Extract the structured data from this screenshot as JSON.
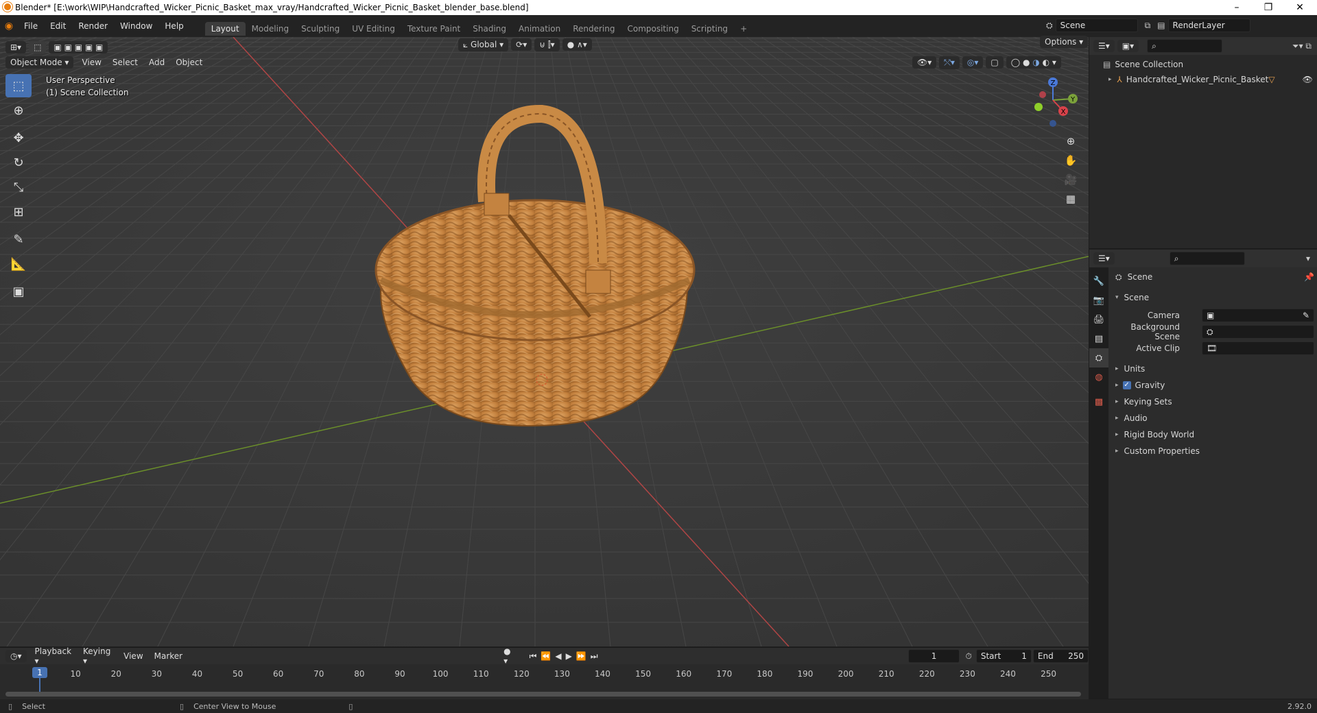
{
  "window": {
    "title": "Blender* [E:\\work\\WIP\\Handcrafted_Wicker_Picnic_Basket_max_vray/Handcrafted_Wicker_Picnic_Basket_blender_base.blend]",
    "controls": [
      "–",
      "❐",
      "✕"
    ]
  },
  "menu": [
    "File",
    "Edit",
    "Render",
    "Window",
    "Help"
  ],
  "workspaces": [
    "Layout",
    "Modeling",
    "Sculpting",
    "UV Editing",
    "Texture Paint",
    "Shading",
    "Animation",
    "Rendering",
    "Compositing",
    "Scripting"
  ],
  "active_workspace": "Layout",
  "scene_field": "Scene",
  "renderlayer_field": "RenderLayer",
  "viewport": {
    "mode": "Object Mode",
    "menus": [
      "View",
      "Select",
      "Add",
      "Object"
    ],
    "orientation": "Global",
    "options": "Options",
    "info_line1": "User Perspective",
    "info_line2": "(1) Scene Collection",
    "gizmo": {
      "z": "Z",
      "y": "Y",
      "x": "X"
    }
  },
  "tools": [
    "select-box",
    "cursor",
    "move",
    "rotate",
    "scale",
    "transform",
    "annotate",
    "measure",
    "add-cube"
  ],
  "outliner": {
    "root": "Scene Collection",
    "items": [
      {
        "label": "Handcrafted_Wicker_Picnic_Basket"
      }
    ]
  },
  "properties": {
    "header": "Scene",
    "section": "Scene",
    "fields": [
      {
        "label": "Camera"
      },
      {
        "label": "Background Scene"
      },
      {
        "label": "Active Clip"
      }
    ],
    "panels": [
      "Units",
      "Gravity",
      "Keying Sets",
      "Audio",
      "Rigid Body World",
      "Custom Properties"
    ],
    "gravity_checked": true
  },
  "timeline": {
    "menus": [
      "Playback",
      "Keying",
      "View",
      "Marker"
    ],
    "current_frame": "1",
    "start_label": "Start",
    "start": "1",
    "end_label": "End",
    "end": "250",
    "ticks": [
      "10",
      "20",
      "30",
      "40",
      "50",
      "60",
      "70",
      "80",
      "90",
      "100",
      "110",
      "120",
      "130",
      "140",
      "150",
      "160",
      "170",
      "180",
      "190",
      "200",
      "210",
      "220",
      "230",
      "240",
      "250"
    ],
    "playhead": "1"
  },
  "status": {
    "left": "Select",
    "middle": "Center View to Mouse",
    "version": "2.92.0"
  },
  "colors": {
    "accent": "#4772b3",
    "x_axis": "#c94a4a",
    "y_axis": "#6c9a2a",
    "wicker": "#c98a45"
  }
}
